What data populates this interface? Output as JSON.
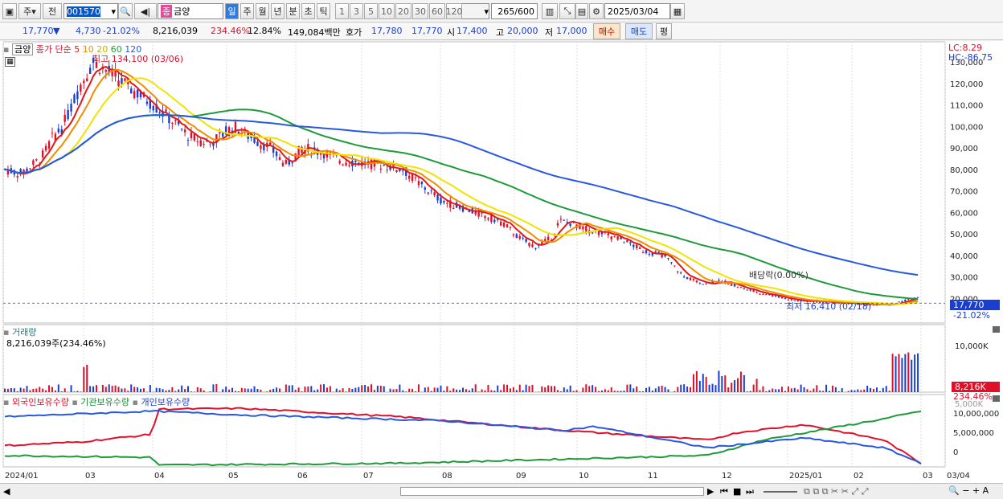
{
  "toolbar": {
    "period_sel": "주",
    "view_sel": "전",
    "code": "001570",
    "stock_name": "금양",
    "tabs": [
      "일",
      "주",
      "월",
      "년",
      "분",
      "초",
      "틱"
    ],
    "active_tab": "일",
    "intervals": [
      "1",
      "3",
      "5",
      "10",
      "20",
      "30",
      "60",
      "120"
    ],
    "count": "265",
    "count_total": "/600",
    "date": "2025/03/04"
  },
  "quote": {
    "price": "17,770",
    "arrow": "▼",
    "change": "4,730",
    "change_pct": "-21.02%",
    "volume": "8,216,039",
    "volume_ratio": "234.46%",
    "turnover_pct": "12.84%",
    "amount": "149,084백만",
    "ask_label": "호가",
    "ask": "17,780",
    "bid": "17,770",
    "open_label": "시",
    "open": "17,400",
    "high_label": "고",
    "high": "20,000",
    "low_label": "저",
    "low": "17,000",
    "buy_label": "매수",
    "sell_label": "매도",
    "eval_label": "평"
  },
  "price_pane": {
    "name": "금양",
    "ma_label": "종가 단순",
    "ma_periods": [
      "5",
      "10",
      "20",
      "60",
      "120"
    ],
    "max_label": "최고 134,100 (03/06)",
    "min_label": "최저 16,410 (02/18)",
    "dividend_label": "배당락(0.00%)",
    "lc": "LC:8.29",
    "hc": "HC:-86.75",
    "price_tag": "17,770",
    "pct_tag": "-21.02%",
    "y_ticks": [
      "130,000",
      "120,000",
      "110,000",
      "100,000",
      "90,000",
      "80,000",
      "70,000",
      "60,000",
      "50,000",
      "40,000",
      "30,000",
      "20,000"
    ]
  },
  "volume_pane": {
    "title": "거래량",
    "value": "8,216,039주(234.46%)",
    "y_tick": "10,000K",
    "y_tick2": "5,000K",
    "tag": "8,216K",
    "tag_pct": "234.46%"
  },
  "holding_pane": {
    "legend": [
      "외국인보유수량",
      "기관보유수량",
      "개인보유수량"
    ],
    "y_ticks": [
      "10,000,000",
      "5,000,000",
      "0"
    ]
  },
  "x_axis": [
    "2024/01",
    "03",
    "04",
    "05",
    "06",
    "07",
    "08",
    "09",
    "10",
    "11",
    "12",
    "2025/01",
    "02",
    "03",
    "03/04"
  ],
  "colors": {
    "up": "#e0102b",
    "down": "#1a3fd0",
    "ma5": "#e01818",
    "ma10": "#f08c00",
    "ma20": "#f2e200",
    "ma60": "#1e9a3a",
    "ma120": "#2858e0"
  }
}
